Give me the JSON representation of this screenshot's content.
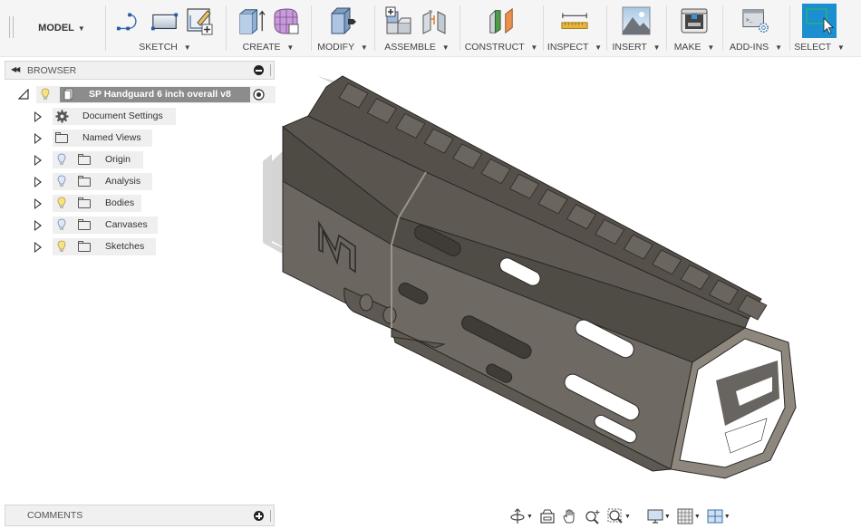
{
  "toolbar": {
    "workspace": "MODEL",
    "groups": [
      {
        "id": "sketch",
        "label": "SKETCH",
        "icons": [
          "sketch-line-icon",
          "sketch-rectangle-icon",
          "create-sketch-icon"
        ]
      },
      {
        "id": "create",
        "label": "CREATE",
        "icons": [
          "extrude-icon",
          "form-icon"
        ]
      },
      {
        "id": "modify",
        "label": "MODIFY",
        "icons": [
          "press-pull-icon"
        ]
      },
      {
        "id": "assemble",
        "label": "ASSEMBLE",
        "icons": [
          "new-component-icon",
          "joint-icon"
        ]
      },
      {
        "id": "construct",
        "label": "CONSTRUCT",
        "icons": [
          "offset-plane-icon"
        ]
      },
      {
        "id": "inspect",
        "label": "INSPECT",
        "icons": [
          "measure-icon"
        ]
      },
      {
        "id": "insert",
        "label": "INSERT",
        "icons": [
          "insert-image-icon"
        ]
      },
      {
        "id": "make",
        "label": "MAKE",
        "icons": [
          "3d-print-icon"
        ]
      },
      {
        "id": "addins",
        "label": "ADD-INS",
        "icons": [
          "scripts-addins-icon"
        ]
      },
      {
        "id": "select",
        "label": "SELECT",
        "icons": [
          "select-icon"
        ]
      }
    ],
    "colors": {
      "select_active": "#1b8fd0"
    }
  },
  "browser": {
    "title": "BROWSER",
    "root": {
      "label": "SP Handguard 6 inch overall v8",
      "visible": true
    },
    "items": [
      {
        "label": "Document Settings",
        "icon": "gear-icon",
        "visibility": null
      },
      {
        "label": "Named Views",
        "icon": "folder-icon",
        "visibility": null
      },
      {
        "label": "Origin",
        "icon": "folder-icon",
        "visibility": "hidden"
      },
      {
        "label": "Analysis",
        "icon": "folder-icon",
        "visibility": "hidden"
      },
      {
        "label": "Bodies",
        "icon": "folder-icon",
        "visibility": "visible"
      },
      {
        "label": "Canvases",
        "icon": "folder-icon",
        "visibility": "hidden"
      },
      {
        "label": "Sketches",
        "icon": "folder-icon",
        "visibility": "visible"
      }
    ]
  },
  "comments": {
    "title": "COMMENTS"
  },
  "navbar": {
    "tools": [
      "orbit-icon",
      "look-at-icon",
      "pan-icon",
      "zoom-icon",
      "fit-window-icon",
      "display-settings-icon",
      "grid-settings-icon",
      "viewports-icon"
    ]
  },
  "model": {
    "name": "handguard",
    "logo_letter": "M",
    "colors": {
      "body_dark": "#4d4943",
      "body_mid": "#5f5a54",
      "body_light": "#76716a",
      "edge": "#2b2825"
    }
  }
}
